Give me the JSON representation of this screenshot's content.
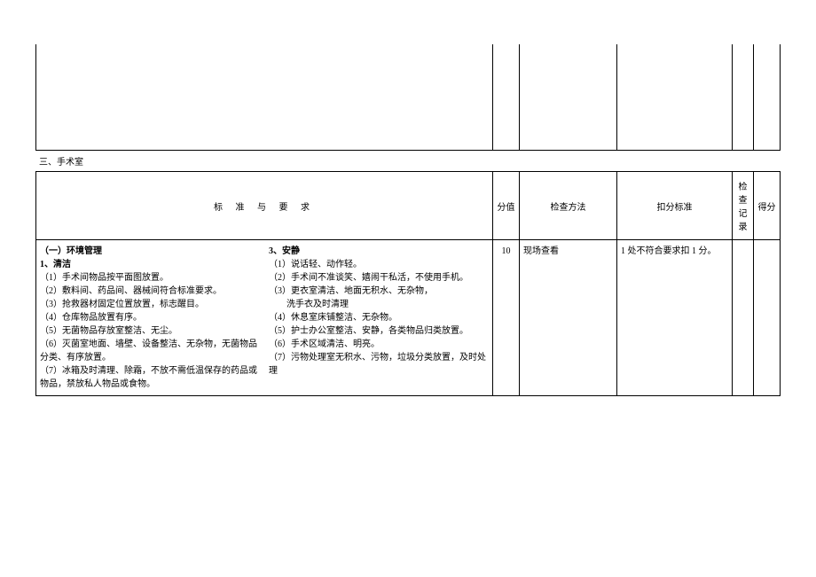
{
  "section_title": "三、手术室",
  "headers": {
    "requirements": "标 准 与 要 求",
    "score": "分值",
    "method": "检查方法",
    "deduct": "扣分标准",
    "record": "检查记录",
    "final": "得分"
  },
  "row": {
    "left": {
      "title1": "（一）环境管理",
      "subtitle1": "1、清洁",
      "items": [
        "（1）手术间物品按平面图放置。",
        "（2）敷料间、药品间、器械间符合标准要求。",
        "（3）抢救器材固定位置放置，标志醒目。",
        "（4）仓库物品放置有序。",
        "（5）无菌物品存放室整洁、无尘。",
        "（6）灭菌室地面、墙壁、设备整洁、无杂物，无菌物品分类、有序放置。",
        "（7）冰箱及时清理、除霜，不放不需低温保存的药品或物品，禁放私人物品或食物。"
      ]
    },
    "right": {
      "subtitle2": "3、安静",
      "items": [
        "（1）说话轻、动作轻。",
        "（2）手术间不准谈笑、嬉闹干私活，不使用手机。",
        "（3）更衣室清洁、地面无积水、无杂物，",
        "　　洗手衣及时清理",
        "（4）休息室床铺整洁、无杂物。",
        "（5）护士办公室整洁、安静，各类物品归类放置。",
        "（6）手术区域清洁、明亮。",
        "（7）污物处理室无积水、污物，垃圾分类放置，及时处理"
      ]
    },
    "score": "10",
    "method": "现场查看",
    "deduct": "1 处不符合要求扣 1 分。"
  }
}
